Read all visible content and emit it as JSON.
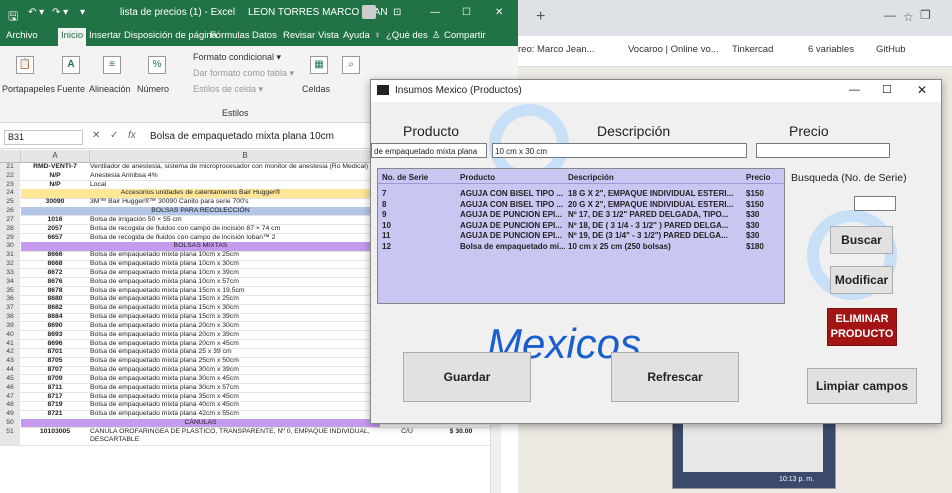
{
  "excel": {
    "title": "lista de precios (1) - Excel",
    "user": "LEON TORRES MARCO JEAN",
    "tabs": [
      "Archivo",
      "Inicio",
      "Insertar",
      "Disposición de página",
      "Fórmulas",
      "Datos",
      "Revisar",
      "Vista",
      "Ayuda"
    ],
    "tell_me": "¿Qué des",
    "share": "Compartir",
    "ribbon": {
      "portapapeles": "Portapapeles",
      "fuente": "Fuente",
      "alineacion": "Alineación",
      "numero": "Número",
      "formato_condicional": "Formato condicional ▾",
      "dar_formato": "Dar formato como tabla ▾",
      "estilos_celda": "Estilos de celda ▾",
      "estilos": "Estilos",
      "celdas": "Celdas"
    },
    "namebox": "B31",
    "formula": "Bolsa de empaquetado mixta plana 10cm",
    "col_a": "A",
    "col_b": "B",
    "rows": [
      {
        "n": "21",
        "a": "RMD-VENTI-7",
        "b": "Ventilador de anestesia, sistema de microprocesador con monitor de anestesia (Ro Medical)"
      },
      {
        "n": "22",
        "a": "N/P",
        "b": "Anestesia Arinibsa 4%"
      },
      {
        "n": "23",
        "a": "N/P",
        "b": "Local"
      },
      {
        "n": "24",
        "sec": "Accesorios unidades de calentamiento Bair Hugger®"
      },
      {
        "n": "25",
        "a": "30090",
        "b": "3M™ Bair Hugger®™ 30090 Canito para serie 700's"
      },
      {
        "n": "26",
        "sec": "BOLSAS PARA RECOLECCIÓN"
      },
      {
        "n": "27",
        "a": "1016",
        "b": "Bolsa de irrigación 50 × 55 cm"
      },
      {
        "n": "28",
        "a": "2057",
        "b": "Bolsa de recogida de fluidos con campo de incisión 87 × 74 cm"
      },
      {
        "n": "29",
        "a": "6657",
        "b": "Bolsa de recogida de fluidos con campo de incisión loban™ 2"
      },
      {
        "n": "30",
        "sec": "BOLSAS MIXTAS"
      },
      {
        "n": "31",
        "a": "8666",
        "b": "Bolsa de empaquetado mixta plana 10cm x 25cm"
      },
      {
        "n": "32",
        "a": "8668",
        "b": "Bolsa de empaquetado mixta plana 10cm x 30cm"
      },
      {
        "n": "33",
        "a": "8672",
        "b": "Bolsa de empaquetado mixta plana 10cm x 39cm"
      },
      {
        "n": "34",
        "a": "8676",
        "b": "Bolsa de empaquetado mixta plana 10cm x 57cm"
      },
      {
        "n": "35",
        "a": "8678",
        "b": "Bolsa de empaquetado mixta plana 15cm x 19,5cm"
      },
      {
        "n": "36",
        "a": "8680",
        "b": "Bolsa de empaquetado mixta plana 15cm x 25cm"
      },
      {
        "n": "37",
        "a": "8682",
        "b": "Bolsa de empaquetado mixta plana 15cm x 30cm"
      },
      {
        "n": "38",
        "a": "8684",
        "b": "Bolsa de empaquetado mixta plana 15cm x 39cm"
      },
      {
        "n": "39",
        "a": "8690",
        "b": "Bolsa de empaquetado mixta plana 20cm x 30cm"
      },
      {
        "n": "40",
        "a": "8693",
        "b": "Bolsa de empaquetado mixta plana 20cm x 39cm"
      },
      {
        "n": "41",
        "a": "8696",
        "b": "Bolsa de empaquetado mixta plana 20cm x 45cm"
      },
      {
        "n": "42",
        "a": "8701",
        "b": "Bolsa de empaquetado mixta plana 25 x 39 cm"
      },
      {
        "n": "43",
        "a": "8705",
        "b": "Bolsa de empaquetado mixta plana 25cm x 50cm"
      },
      {
        "n": "44",
        "a": "8707",
        "b": "Bolsa de empaquetado mixta plana 30cm x 39cm"
      },
      {
        "n": "45",
        "a": "8709",
        "b": "Bolsa de empaquetado mixta plana 30cm x 45cm"
      },
      {
        "n": "46",
        "a": "8711",
        "b": "Bolsa de empaquetado mixta plana 30cm x 57cm",
        "c": "250 bolsas",
        "d": "########"
      },
      {
        "n": "47",
        "a": "8717",
        "b": "Bolsa de empaquetado mixta plana 35cm x 45cm",
        "c": "250 bolsas",
        "d": "########"
      },
      {
        "n": "48",
        "a": "8719",
        "b": "Bolsa de empaquetado mixta plana 40cm x 45cm",
        "c": "250 bolsas",
        "d": "########"
      },
      {
        "n": "49",
        "a": "8721",
        "b": "Bolsa de empaquetado mixta plana 42cm x 55cm",
        "c": "250 bolsas",
        "d": "########"
      },
      {
        "n": "50",
        "sec": "CÁNULAS"
      },
      {
        "n": "51",
        "a": "10103005",
        "b": "CANULA OROFARINGEA DE PLÁSTICO, TRANSPARENTE, Nº 0, EMPAQUE INDIVIDUAL, DESCARTABLE",
        "c": "C/U",
        "d": "$ 30.00"
      }
    ]
  },
  "browser": {
    "bookmarks": [
      "reo: Marco Jean...",
      "Vocaroo | Online vo...",
      "Tinkercad",
      "6 variables",
      "GitHub"
    ],
    "clock": "10:13 p. m."
  },
  "dialog": {
    "title": "Insumos Mexico (Productos)",
    "label_producto": "Producto",
    "label_descripcion": "Descripción",
    "label_precio": "Precio",
    "producto_value": "de empaquetado mixta plana",
    "descripcion_value": "10 cm x 30 cm",
    "precio_value": "",
    "busqueda_label": "Busqueda (No. de Serie)",
    "busqueda_value": "",
    "watermark": "Mexicos",
    "list_headers": [
      "No. de Serie",
      "Producto",
      "Descripción",
      "Precio"
    ],
    "list_rows": [
      {
        "serie": "7",
        "producto": "AGUJA CON BISEL TIPO ...",
        "desc": "18 G X 2\", EMPAQUE INDIVIDUAL ESTERI...",
        "precio": "$150"
      },
      {
        "serie": "8",
        "producto": "AGUJA CON BISEL TIPO ...",
        "desc": "20 G X 2\", EMPAQUE INDIVIDUAL ESTERI...",
        "precio": "$150"
      },
      {
        "serie": "9",
        "producto": "AGUJA DE PUNCION EPI...",
        "desc": "Nº 17, DE 3 1/2\" PARED DELGADA, TIPO...",
        "precio": "$30"
      },
      {
        "serie": "10",
        "producto": "AGUJA DE PUNCION EPI...",
        "desc": "Nº 18, DE ( 3 1/4 - 3 1/2\" ) PARED DELGA...",
        "precio": "$30"
      },
      {
        "serie": "11",
        "producto": "AGUJA DE PUNCION EPI...",
        "desc": "Nº 19, DE (3 1/4\" - 3 1/2\") PARED DELGA...",
        "precio": "$30"
      },
      {
        "serie": "12",
        "producto": "Bolsa de empaquetado mi...",
        "desc": "10 cm x 25 cm (250 bolsas)",
        "precio": "$180"
      }
    ],
    "buttons": {
      "buscar": "Buscar",
      "modificar": "Modificar",
      "eliminar": "ELIMINAR PRODUCTO",
      "guardar": "Guardar",
      "refrescar": "Refrescar",
      "limpiar": "Limpiar campos"
    },
    "colors": {
      "list_bg": "#c9c6f2",
      "eliminar_bg": "#a31515",
      "accent": "#1a73e8"
    }
  }
}
